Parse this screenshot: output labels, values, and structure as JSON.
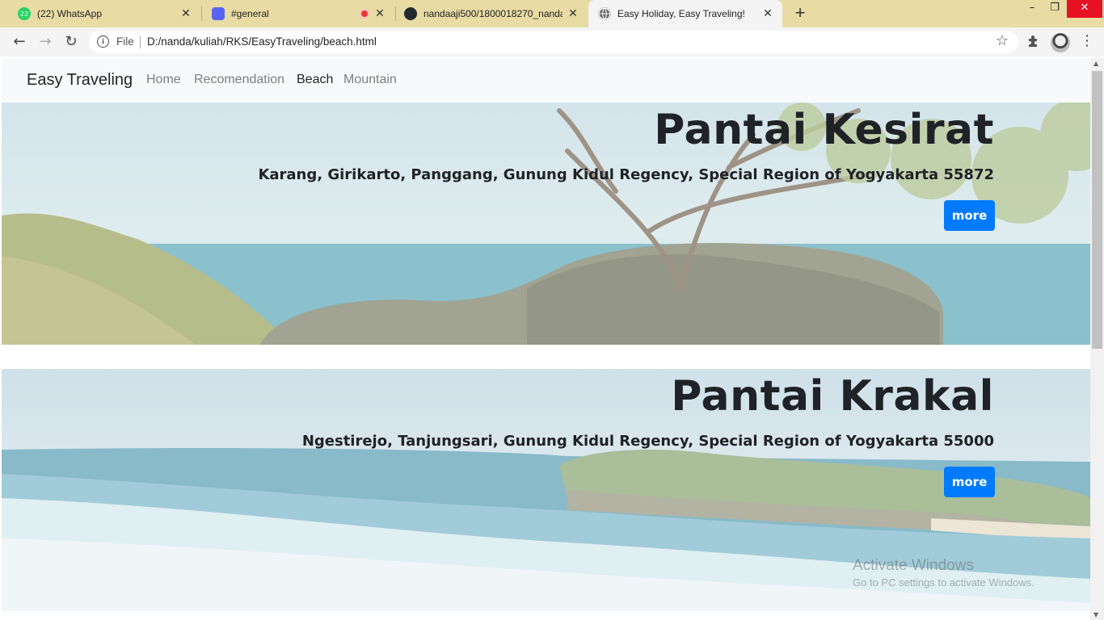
{
  "browser": {
    "tabs": [
      {
        "title": "(22) WhatsApp",
        "badge": "22",
        "icon": "whatsapp-icon",
        "close": "✕"
      },
      {
        "title": "#general",
        "icon": "discord-icon",
        "close": "✕"
      },
      {
        "title": "nandaaji500/1800018270_nanda",
        "icon": "github-icon",
        "close": "✕"
      },
      {
        "title": "Easy Holiday, Easy Traveling!",
        "icon": "globe-icon",
        "close": "✕"
      }
    ],
    "new_tab": "+",
    "address": {
      "scheme": "File",
      "url": "D:/nanda/kuliah/RKS/EasyTraveling/beach.html"
    }
  },
  "page": {
    "brand": "Easy Traveling",
    "nav": [
      {
        "label": "Home"
      },
      {
        "label": "Recomendation"
      },
      {
        "label": "Beach"
      },
      {
        "label": "Mountain"
      }
    ],
    "beaches": [
      {
        "name": "Pantai Kesirat",
        "address": "Karang, Girikarto, Panggang, Gunung Kidul Regency, Special Region of Yogyakarta 55872",
        "button": "more"
      },
      {
        "name": "Pantai Krakal",
        "address": "Ngestirejo, Tanjungsari, Gunung Kidul Regency, Special Region of Yogyakarta 55000",
        "button": "more"
      }
    ]
  },
  "watermark": {
    "line1": "Activate Windows",
    "line2": "Go to PC settings to activate Windows."
  },
  "colors": {
    "accent": "#007bff",
    "tabstrip": "#e8dba3",
    "navbar": "#f8f9fa"
  }
}
